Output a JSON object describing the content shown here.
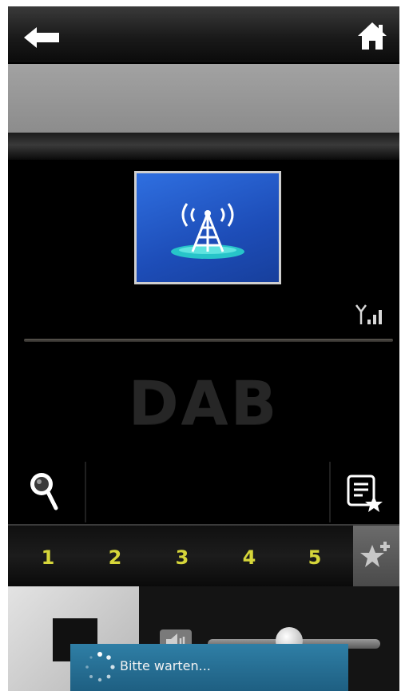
{
  "topbar": {
    "back_icon": "arrow-left-icon",
    "home_icon": "home-icon"
  },
  "station": {
    "logo_icon": "radio-tower-icon",
    "signal_icon": "signal-strength-icon",
    "source_label": "DAB"
  },
  "toolbar": {
    "search_icon": "search-icon",
    "favorites_icon": "favorites-list-icon"
  },
  "presets": {
    "items": [
      "1",
      "2",
      "3",
      "4",
      "5"
    ],
    "add_icon": "star-add-icon",
    "accent": "#d6d63a"
  },
  "volume": {
    "icon": "speaker-icon",
    "level": 0.47
  },
  "toast": {
    "message": "Bitte warten...",
    "color": "#2a7299"
  }
}
